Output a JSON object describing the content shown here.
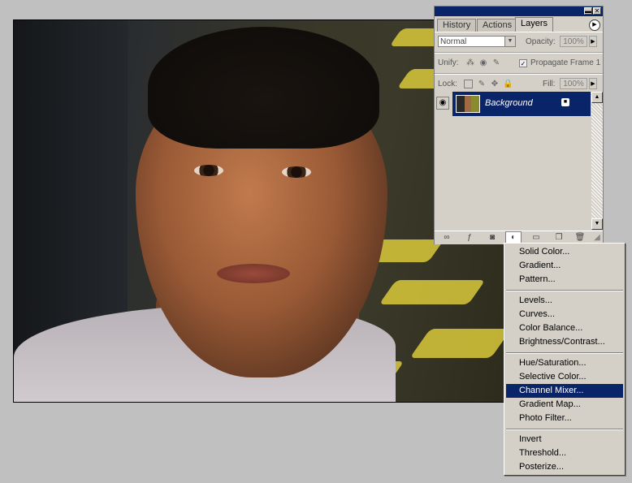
{
  "palette": {
    "tabs": [
      "History",
      "Actions",
      "Layers"
    ],
    "active_tab": "Layers",
    "blend_mode": "Normal",
    "opacity_label": "Opacity:",
    "opacity_value": "100%",
    "unify_label": "Unify:",
    "propagate_label": "Propagate Frame 1",
    "lock_label": "Lock:",
    "fill_label": "Fill:",
    "fill_value": "100%",
    "layer_name": "Background"
  },
  "menu": {
    "items": [
      "Solid Color...",
      "Gradient...",
      "Pattern...",
      "Levels...",
      "Curves...",
      "Color Balance...",
      "Brightness/Contrast...",
      "Hue/Saturation...",
      "Selective Color...",
      "Channel Mixer...",
      "Gradient Map...",
      "Photo Filter...",
      "Invert",
      "Threshold...",
      "Posterize..."
    ],
    "highlighted": "Channel Mixer..."
  },
  "colors": {
    "selection": "#0a246a",
    "panel": "#d4d0c8",
    "desktop": "#c0c0c0"
  }
}
